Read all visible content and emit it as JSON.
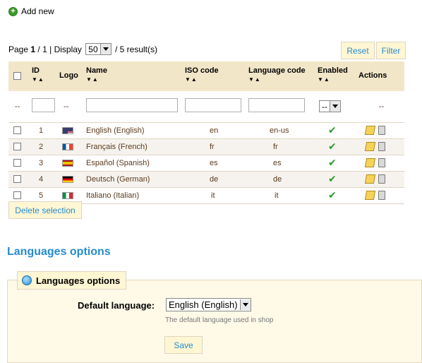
{
  "toolbar": {
    "add_new": "Add new"
  },
  "pager": {
    "page_prefix": "Page",
    "page_current": "1",
    "page_sep": "/",
    "page_total": "1",
    "display_label": "| Display",
    "per_page": "50",
    "results": "/ 5 result(s)"
  },
  "buttons": {
    "reset": "Reset",
    "filter": "Filter",
    "delete_selection": "Delete selection",
    "save": "Save"
  },
  "table": {
    "headers": [
      "ID",
      "Logo",
      "Name",
      "ISO code",
      "Language code",
      "Enabled",
      "Actions"
    ],
    "filter_placeholders": {
      "checkbox": "--",
      "logo": "--",
      "enabled": "--",
      "actions": "--"
    },
    "rows": [
      {
        "id": "1",
        "name": "English (English)",
        "iso": "en",
        "lang": "en-us",
        "flag": "us"
      },
      {
        "id": "2",
        "name": "Français (French)",
        "iso": "fr",
        "lang": "fr",
        "flag": "fr"
      },
      {
        "id": "3",
        "name": "Español (Spanish)",
        "iso": "es",
        "lang": "es",
        "flag": "es"
      },
      {
        "id": "4",
        "name": "Deutsch (German)",
        "iso": "de",
        "lang": "de",
        "flag": "de"
      },
      {
        "id": "5",
        "name": "Italiano (Italian)",
        "iso": "it",
        "lang": "it",
        "flag": "it"
      }
    ]
  },
  "options": {
    "section_title": "Languages options",
    "legend": "Languages options",
    "default_language_label": "Default language:",
    "default_language_value": "English (English)",
    "help_text": "The default language used in shop"
  },
  "colors": {
    "accent": "#268ccd",
    "header_bg": "#f1e6c8",
    "button_bg": "#fff6d3",
    "enabled_check": "#2e9a2e"
  }
}
